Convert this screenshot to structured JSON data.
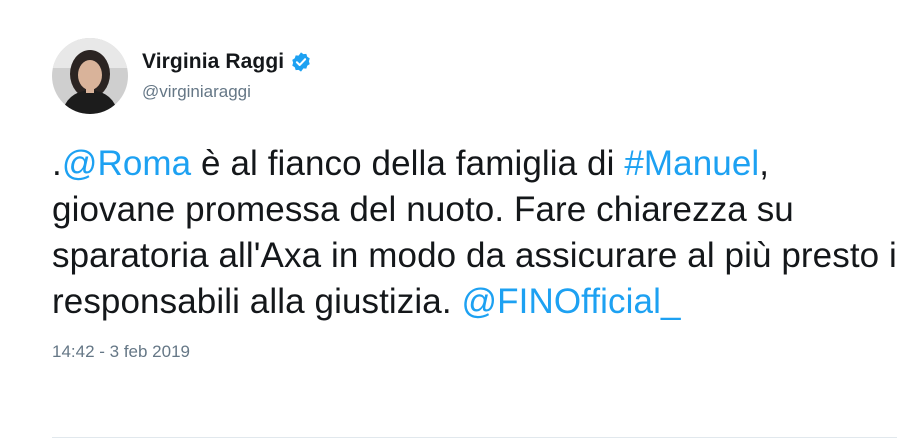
{
  "author": {
    "display_name": "Virginia Raggi",
    "handle": "@virginiaraggi",
    "verified": true,
    "verified_icon": "verified-badge-icon",
    "verified_color": "#1da1f2"
  },
  "tweet": {
    "segments": [
      {
        "text": ".",
        "type": "text"
      },
      {
        "text": "@Roma",
        "type": "mention"
      },
      {
        "text": " è al fianco della famiglia di ",
        "type": "text"
      },
      {
        "text": "#Manuel",
        "type": "hashtag"
      },
      {
        "text": ", giovane promessa del nuoto. Fare chiarezza su sparatoria all'Axa in modo da assicurare al più presto i responsabili alla giustizia. ",
        "type": "text"
      },
      {
        "text": "@FINOfficial_",
        "type": "mention"
      }
    ],
    "timestamp": "14:42 - 3 feb 2019"
  },
  "colors": {
    "link": "#1da1f2",
    "text": "#14171a",
    "muted": "#657786"
  }
}
